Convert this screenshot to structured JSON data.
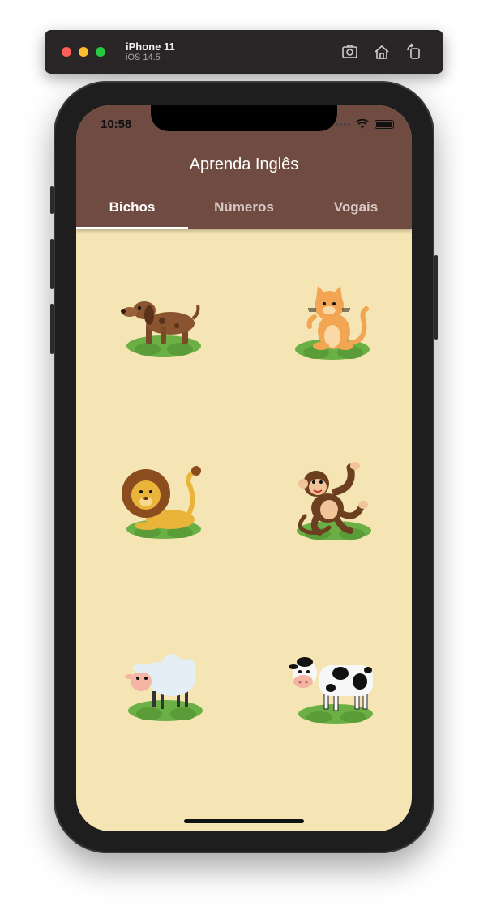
{
  "simulator": {
    "device_name": "iPhone 11",
    "os_version": "iOS 14.5",
    "toolbar": {
      "screenshot_icon": "camera-icon",
      "home_icon": "home-icon",
      "rotate_icon": "rotate-icon"
    }
  },
  "status_bar": {
    "time": "10:58"
  },
  "app": {
    "title": "Aprenda Inglês",
    "colors": {
      "appbar": "#704b41",
      "background": "#f5e4b4",
      "tab_active": "#ffffff",
      "tab_inactive": "#d8c8c3"
    }
  },
  "tabs": [
    {
      "label": "Bichos",
      "selected": true
    },
    {
      "label": "Números",
      "selected": false
    },
    {
      "label": "Vogais",
      "selected": false
    }
  ],
  "animals": [
    {
      "name": "dog",
      "icon": "dog-icon"
    },
    {
      "name": "cat",
      "icon": "cat-icon"
    },
    {
      "name": "lion",
      "icon": "lion-icon"
    },
    {
      "name": "monkey",
      "icon": "monkey-icon"
    },
    {
      "name": "sheep",
      "icon": "sheep-icon"
    },
    {
      "name": "cow",
      "icon": "cow-icon"
    }
  ]
}
